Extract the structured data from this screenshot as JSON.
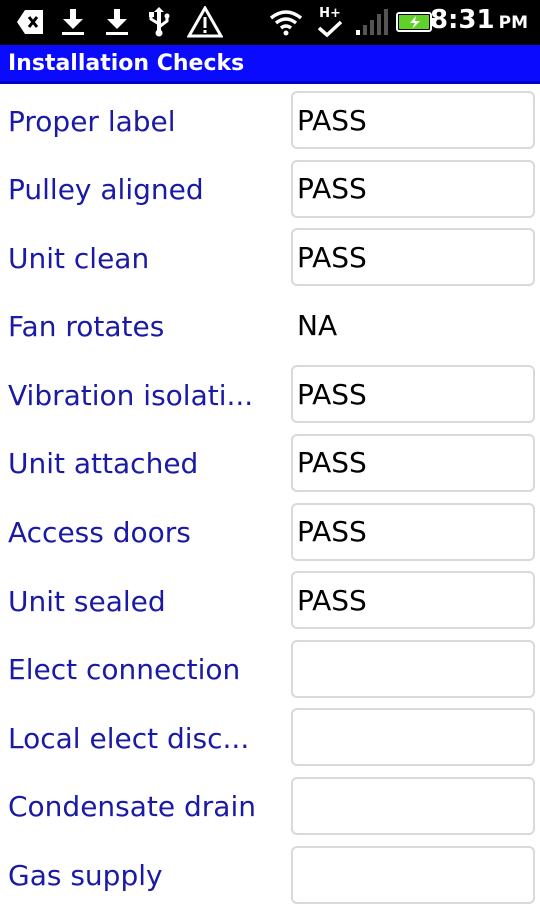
{
  "status_bar": {
    "time": "8:31",
    "ampm": "PM",
    "icons": [
      "back-arrow-icon",
      "download-icon",
      "download-icon",
      "usb-icon",
      "warning-icon",
      "wifi-icon",
      "hplus-icon",
      "signal-icon",
      "battery-icon"
    ],
    "network_label": "H+"
  },
  "title_bar": {
    "title": "Installation Checks"
  },
  "rows": [
    {
      "label": "Proper label",
      "value": "PASS"
    },
    {
      "label": "Pulley aligned",
      "value": "PASS"
    },
    {
      "label": "Unit clean",
      "value": "PASS"
    },
    {
      "label": "Fan rotates",
      "value": "NA"
    },
    {
      "label": "Vibration isolati...",
      "value": "PASS"
    },
    {
      "label": "Unit attached",
      "value": "PASS"
    },
    {
      "label": "Access doors",
      "value": "PASS"
    },
    {
      "label": "Unit sealed",
      "value": "PASS"
    },
    {
      "label": "Elect connection",
      "value": ""
    },
    {
      "label": "Local elect disc...",
      "value": ""
    },
    {
      "label": "Condensate drain",
      "value": ""
    },
    {
      "label": "Gas supply",
      "value": ""
    }
  ],
  "colors": {
    "title_bar": "#0a0aff",
    "label_text": "#1a1aa6"
  }
}
